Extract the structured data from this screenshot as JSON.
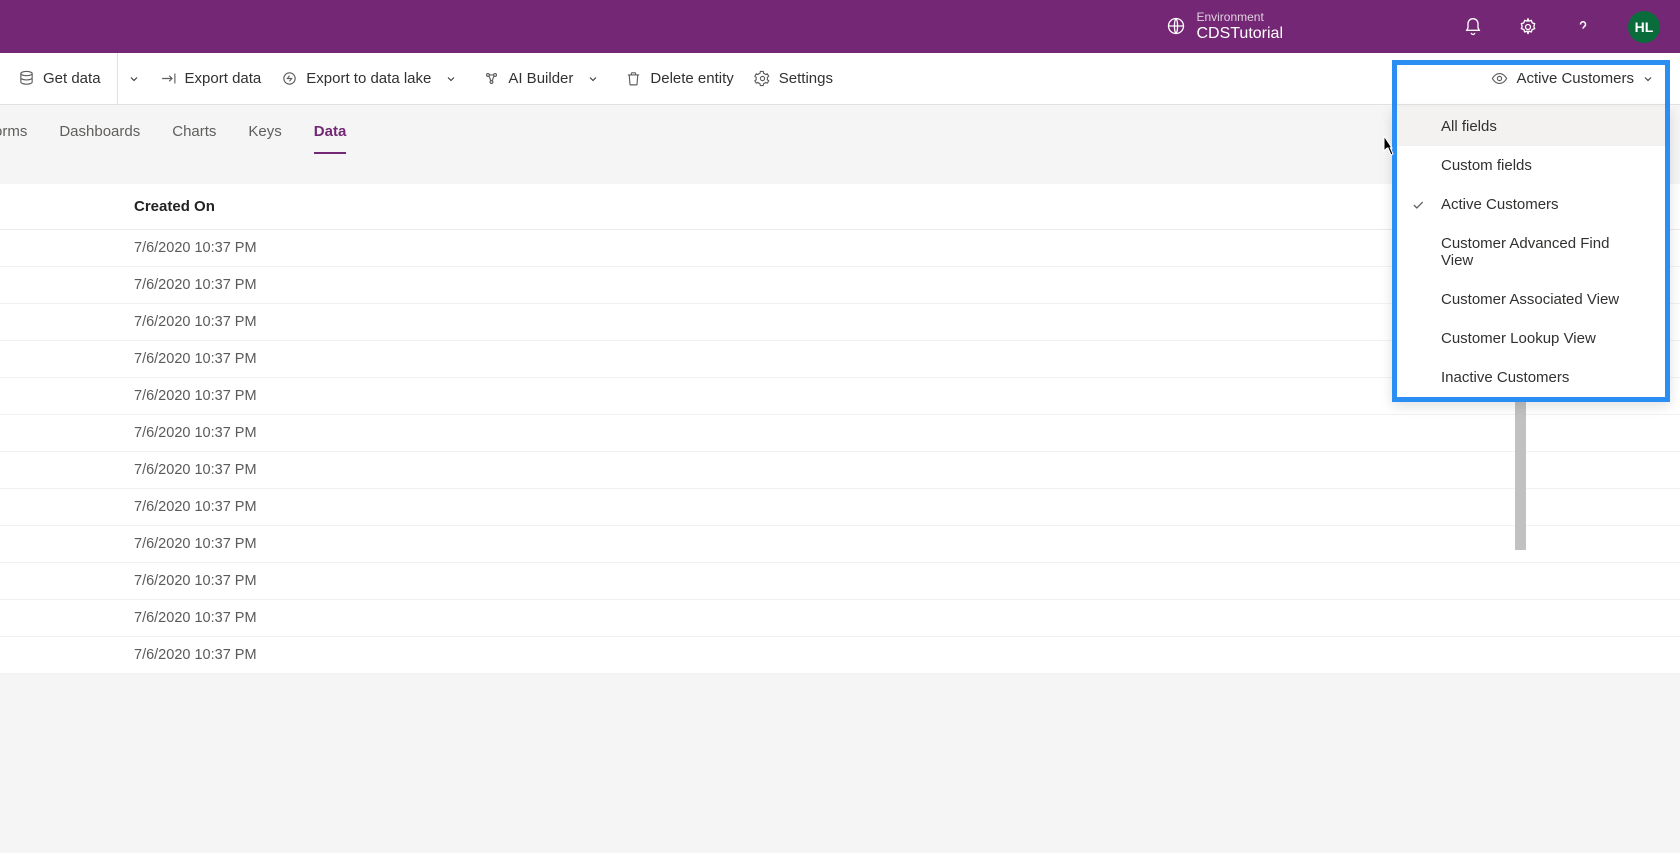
{
  "header": {
    "env_label": "Environment",
    "env_name": "CDSTutorial",
    "avatar_initials": "HL"
  },
  "commands": {
    "get_data": "Get data",
    "export_data": "Export data",
    "export_lake": "Export to data lake",
    "ai_builder": "AI Builder",
    "delete_entity": "Delete entity",
    "settings": "Settings"
  },
  "view_selector": {
    "current": "Active Customers",
    "options": [
      {
        "label": "All fields",
        "checked": false
      },
      {
        "label": "Custom fields",
        "checked": false
      },
      {
        "label": "Active Customers",
        "checked": true
      },
      {
        "label": "Customer Advanced Find View",
        "checked": false
      },
      {
        "label": "Customer Associated View",
        "checked": false
      },
      {
        "label": "Customer Lookup View",
        "checked": false
      },
      {
        "label": "Inactive Customers",
        "checked": false
      }
    ]
  },
  "tabs": {
    "items": [
      {
        "label": "orms"
      },
      {
        "label": "Dashboards"
      },
      {
        "label": "Charts"
      },
      {
        "label": "Keys"
      },
      {
        "label": "Data"
      }
    ],
    "active_index": 4
  },
  "table": {
    "column_header": "Created On",
    "rows": [
      "7/6/2020 10:37 PM",
      "7/6/2020 10:37 PM",
      "7/6/2020 10:37 PM",
      "7/6/2020 10:37 PM",
      "7/6/2020 10:37 PM",
      "7/6/2020 10:37 PM",
      "7/6/2020 10:37 PM",
      "7/6/2020 10:37 PM",
      "7/6/2020 10:37 PM",
      "7/6/2020 10:37 PM",
      "7/6/2020 10:37 PM",
      "7/6/2020 10:37 PM"
    ]
  }
}
